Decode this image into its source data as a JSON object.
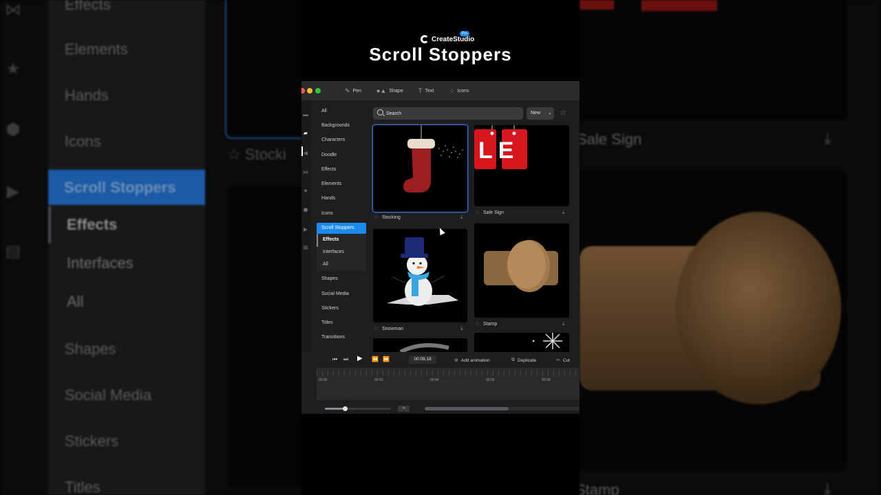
{
  "branding": {
    "logo_text": "CreateStudio",
    "pro_badge": "Pro",
    "headline": "Scroll Stoppers"
  },
  "toolbar": {
    "pen": "Pen",
    "shape": "Shape",
    "text": "Text",
    "icons": "Icons",
    "icon_names": [
      "pen-icon",
      "shape-icon",
      "text-icon",
      "grid-icon"
    ]
  },
  "categories": [
    "All",
    "Backgrounds",
    "Characters",
    "Doodle",
    "Effects",
    "Elements",
    "Hands",
    "Icons",
    "Scroll Stoppers",
    "Shapes",
    "Social Media",
    "Stickers",
    "Titles",
    "Transitions"
  ],
  "selected_category": "Scroll Stoppers",
  "subcategories": [
    "Effects",
    "Interfaces",
    "All"
  ],
  "selected_subcategory": "Effects",
  "search": {
    "placeholder": "Search"
  },
  "sort": {
    "value": "New"
  },
  "assets": [
    {
      "label": "Stocking",
      "selected": true
    },
    {
      "label": "Sale Sign",
      "selected": false,
      "image_text": "LE"
    },
    {
      "label": "Snowman",
      "selected": false
    },
    {
      "label": "Stamp",
      "selected": false
    }
  ],
  "timeline": {
    "timecode": "00:09,18",
    "add_animation": "Add animation",
    "duplicate": "Duplicate",
    "cut": "Cut",
    "ticks": [
      "00:00",
      "00:02",
      "00:04",
      "00:06",
      "00:08"
    ],
    "zoom_level": 0.3,
    "scroll_thumb_fraction": 0.54
  },
  "background": {
    "left_items": [
      "Effects",
      "Elements",
      "Hands",
      "Icons",
      "Scroll Stoppers",
      "Effects",
      "Interfaces",
      "All",
      "Shapes",
      "Social Media",
      "Stickers",
      "Titles"
    ],
    "left_card_label": "Stocki",
    "right_labels": [
      "Sale Sign",
      "Stamp"
    ]
  },
  "colors": {
    "accent": "#1c8bf0",
    "close": "#ff5f57",
    "minimize": "#febc2e",
    "zoom": "#28c840",
    "background": "#1e1e20"
  }
}
